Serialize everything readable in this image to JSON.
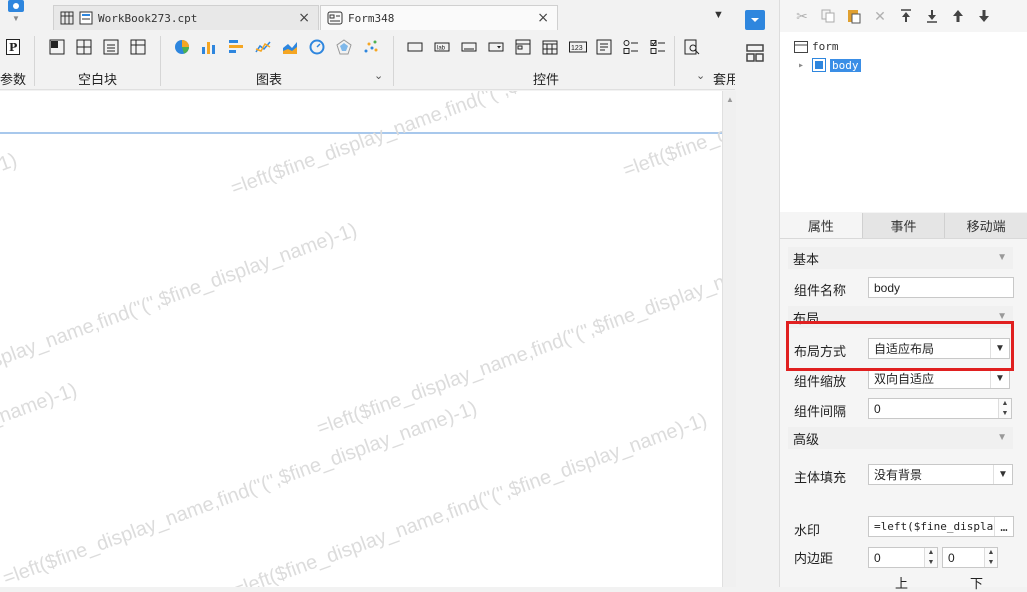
{
  "tabs": [
    {
      "label": "WorkBook273.cpt",
      "close": "×"
    },
    {
      "label": "Form348",
      "close": "×"
    }
  ],
  "tab_dropdown": "▼",
  "toolbar": {
    "groups": [
      {
        "label": "参数"
      },
      {
        "label": "空白块"
      },
      {
        "label": "图表"
      },
      {
        "label": "控件"
      },
      {
        "label": "套用"
      }
    ],
    "caret": "⌄"
  },
  "canvas": {
    "watermark_texts": [
      "=left($fine_display_name,find(\"(\",$fine_display_name)-1)"
    ]
  },
  "tree": {
    "root": "form",
    "child": "body",
    "expander": "▸"
  },
  "prop_tabs": [
    "属性",
    "事件",
    "移动端"
  ],
  "sections": {
    "basic": "基本",
    "layout": "布局",
    "advanced": "高级"
  },
  "props": {
    "name_label": "组件名称",
    "name_value": "body",
    "layout_mode_label": "布局方式",
    "layout_mode_value": "自适应布局",
    "scale_label": "组件缩放",
    "scale_value": "双向自适应",
    "gap_label": "组件间隔",
    "gap_value": "0",
    "fill_label": "主体填充",
    "fill_value": "没有背景",
    "watermark_label": "水印",
    "watermark_value": "=left($fine_display_n",
    "watermark_more": "…",
    "padding_label": "内边距",
    "padding_top": "0",
    "padding_bottom": "0",
    "padding_top_label": "上",
    "padding_bottom_label": "下"
  },
  "colors": {
    "selection": "#3a8ee6",
    "highlight": "#e02020",
    "chart_blue": "#2e86de",
    "chart_orange": "#f5a623"
  }
}
